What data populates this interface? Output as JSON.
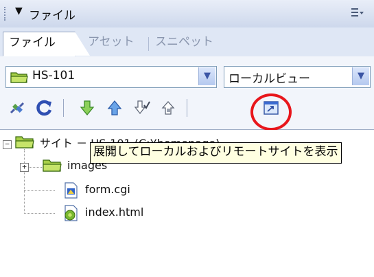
{
  "panel": {
    "title": "ファイル",
    "collapse_arrow": "▼"
  },
  "tabs": [
    {
      "label": "ファイル",
      "active": true
    },
    {
      "label": "アセット",
      "active": false
    },
    {
      "label": "スニペット",
      "active": false
    }
  ],
  "site_select": {
    "value": "HS-101"
  },
  "view_select": {
    "value": "ローカルビュー"
  },
  "toolbar": {
    "buttons": [
      {
        "icon": "connect-icon"
      },
      {
        "icon": "refresh-icon"
      },
      {
        "icon": "get-down-arrow-icon"
      },
      {
        "icon": "put-up-arrow-icon"
      },
      {
        "icon": "check-out-icon"
      },
      {
        "icon": "check-in-icon"
      },
      {
        "icon": "expand-view-icon",
        "highlighted": true
      }
    ]
  },
  "tree": {
    "root": {
      "label": "サイト － HS-101 (C:¥homepage)"
    },
    "items": [
      {
        "label": "images",
        "type": "folder"
      },
      {
        "label": "form.cgi",
        "type": "file"
      },
      {
        "label": "index.html",
        "type": "file"
      }
    ]
  },
  "tooltip": {
    "text": "展開してローカルおよびリモートサイトを表示"
  },
  "colors": {
    "highlight_circle": "#e8161c",
    "tooltip_bg": "#ffffe1",
    "folder": "#9cc63c"
  }
}
